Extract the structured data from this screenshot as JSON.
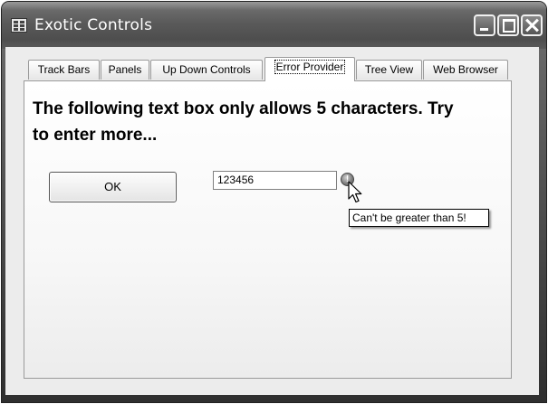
{
  "window": {
    "title": "Exotic Controls"
  },
  "tabs": [
    {
      "label": "Track Bars",
      "active": false
    },
    {
      "label": "Panels",
      "active": false
    },
    {
      "label": "Up Down Controls",
      "active": false
    },
    {
      "label": "Error Provider",
      "active": true
    },
    {
      "label": "Tree View",
      "active": false
    },
    {
      "label": "Web Browser",
      "active": false
    }
  ],
  "panel": {
    "heading": "The following text box only allows 5 characters.  Try to enter more...",
    "ok_label": "OK",
    "textbox_value": "123456",
    "error_icon_glyph": "!",
    "error_tooltip": "Can't be greater than 5!"
  }
}
